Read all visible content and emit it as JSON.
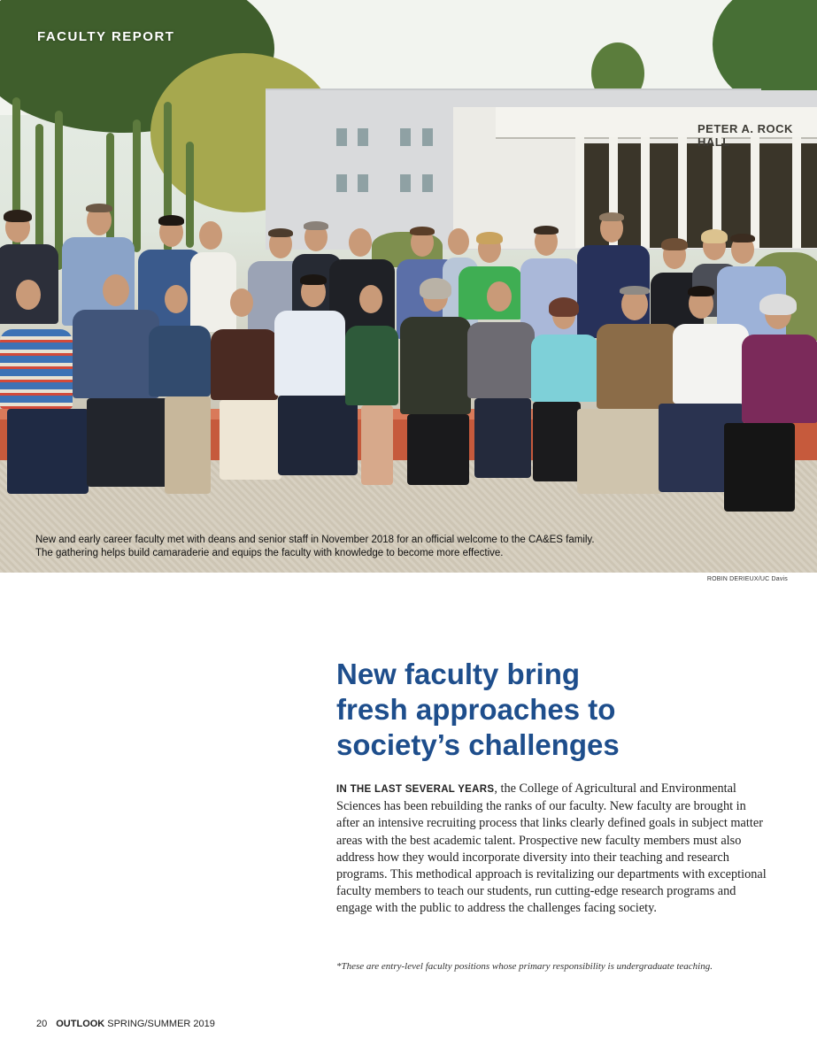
{
  "section_label": "FACULTY REPORT",
  "photo": {
    "building_sign": "PETER A. ROCK HALL",
    "caption_line1": "New and early career faculty met with deans and senior staff in November 2018 for an official welcome to the CA&ES family.",
    "caption_line2": "The gathering helps build camaraderie and equips the faculty with knowledge to become more effective.",
    "credit": "ROBIN DERIEUX/UC Davis"
  },
  "article": {
    "headline_line1": "New faculty bring",
    "headline_line2": "fresh approaches to",
    "headline_line3": "society’s challenges",
    "lead_in": "IN THE LAST SEVERAL YEARS",
    "body": ", the College of Agricultural and Environmental Sciences has been rebuilding the ranks of our faculty. New faculty are brought in after an intensive recruiting process that links clearly defined goals in subject matter areas with the best academic talent. Prospective new faculty members must also address how they would incorporate diversity into their teaching and research programs. This methodical approach is revitalizing our departments with exceptional faculty members to teach our students, run cutting-edge research programs and engage with the public to address the challenges facing society.",
    "footnote": "*These are entry-level faculty positions whose primary responsibility is undergraduate teaching."
  },
  "footer": {
    "page_number": "20",
    "magazine": "OUTLOOK",
    "issue": "SPRING/SUMMER 2019"
  },
  "colors": {
    "headline": "#1e4e8c",
    "wall": "#c65a3c"
  }
}
